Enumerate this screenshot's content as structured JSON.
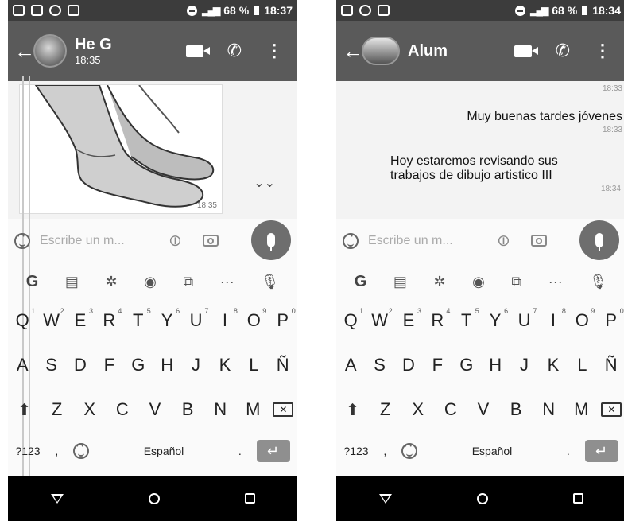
{
  "left": {
    "status": {
      "battery": "68 %",
      "time": "18:37"
    },
    "chat": {
      "name": "He G",
      "subtitle": "18:35"
    },
    "photo_time": "18:35",
    "input_placeholder": "Escribe un m...",
    "keyboard": {
      "row1": [
        "Q",
        "W",
        "E",
        "R",
        "T",
        "Y",
        "U",
        "I",
        "O",
        "P"
      ],
      "row1_hints": [
        "1",
        "2",
        "3",
        "4",
        "5",
        "6",
        "7",
        "8",
        "9",
        "0"
      ],
      "row2": [
        "A",
        "S",
        "D",
        "F",
        "G",
        "H",
        "J",
        "K",
        "L",
        "Ñ"
      ],
      "row3": [
        "Z",
        "X",
        "C",
        "V",
        "B",
        "N",
        "M"
      ],
      "mode_key": "?123",
      "comma": ",",
      "language": "Español",
      "period": "."
    }
  },
  "right": {
    "status": {
      "battery": "68 %",
      "time": "18:34"
    },
    "chat": {
      "name": "Alum"
    },
    "messages": [
      {
        "text": "",
        "time": "18:33"
      },
      {
        "text": "Muy buenas tardes jóvenes",
        "time": "18:33"
      },
      {
        "text": "Hoy estaremos revisando sus trabajos de dibujo artistico III",
        "time": "18:34"
      }
    ],
    "input_placeholder": "Escribe un m...",
    "keyboard": {
      "row1": [
        "Q",
        "W",
        "E",
        "R",
        "T",
        "Y",
        "U",
        "I",
        "O",
        "P"
      ],
      "row1_hints": [
        "1",
        "2",
        "3",
        "4",
        "5",
        "6",
        "7",
        "8",
        "9",
        "0"
      ],
      "row2": [
        "A",
        "S",
        "D",
        "F",
        "G",
        "H",
        "J",
        "K",
        "L",
        "Ñ"
      ],
      "row3": [
        "Z",
        "X",
        "C",
        "V",
        "B",
        "N",
        "M"
      ],
      "mode_key": "?123",
      "comma": ",",
      "language": "Español",
      "period": "."
    }
  },
  "icons": {
    "status": [
      "message-icon",
      "facebook-icon",
      "whatsapp-icon",
      "image-icon"
    ],
    "toolbar": [
      "g-icon",
      "clipboard-icon",
      "settings-icon",
      "palette-icon",
      "resize-icon",
      "more-icon",
      "mic-icon"
    ]
  }
}
